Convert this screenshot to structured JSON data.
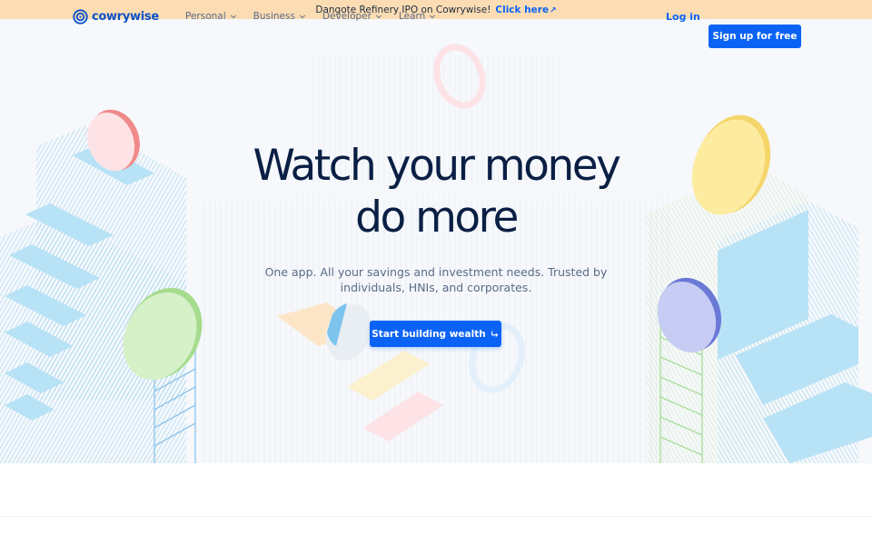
{
  "announcement": {
    "text": "Dangote Refinery IPO on Cowrywise!",
    "link_label": "Click here",
    "link_icon": "external-arrow-icon"
  },
  "nav": {
    "logo_text": "cowrywise",
    "menu": [
      {
        "label": "Personal"
      },
      {
        "label": "Business"
      },
      {
        "label": "Developer"
      },
      {
        "label": "Learn"
      }
    ],
    "login_label": "Log in",
    "signup_label": "Sign up for free"
  },
  "hero": {
    "headline_line1": "Watch your money",
    "headline_line2": "do more",
    "subtitle": "One app. All your savings and investment needs. Trusted by individuals, HNIs, and corporates.",
    "cta_label": "Start building wealth",
    "cta_icon": "arrow-turn-icon"
  },
  "colors": {
    "accent": "#0b63f6",
    "announcement_bg": "#fcdcb3",
    "headline": "#0a1f44",
    "coin_red": "#f08a8a",
    "coin_green": "#b9e6a6",
    "coin_yellow": "#fbe58a",
    "coin_purple": "#7f8ee0",
    "stair_blue": "#b8e2f6"
  }
}
